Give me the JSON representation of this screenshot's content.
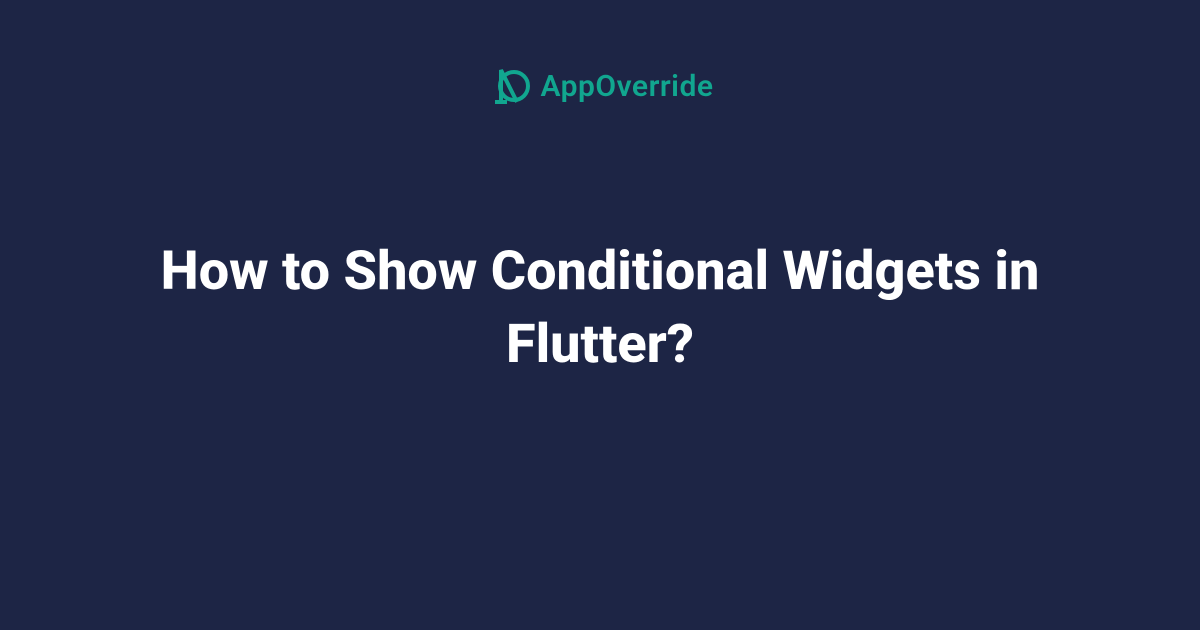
{
  "brand": {
    "name": "AppOverride",
    "accent_color": "#11a68f"
  },
  "headline": "How to Show Conditional Widgets in Flutter?",
  "background_color": "#1d2545"
}
